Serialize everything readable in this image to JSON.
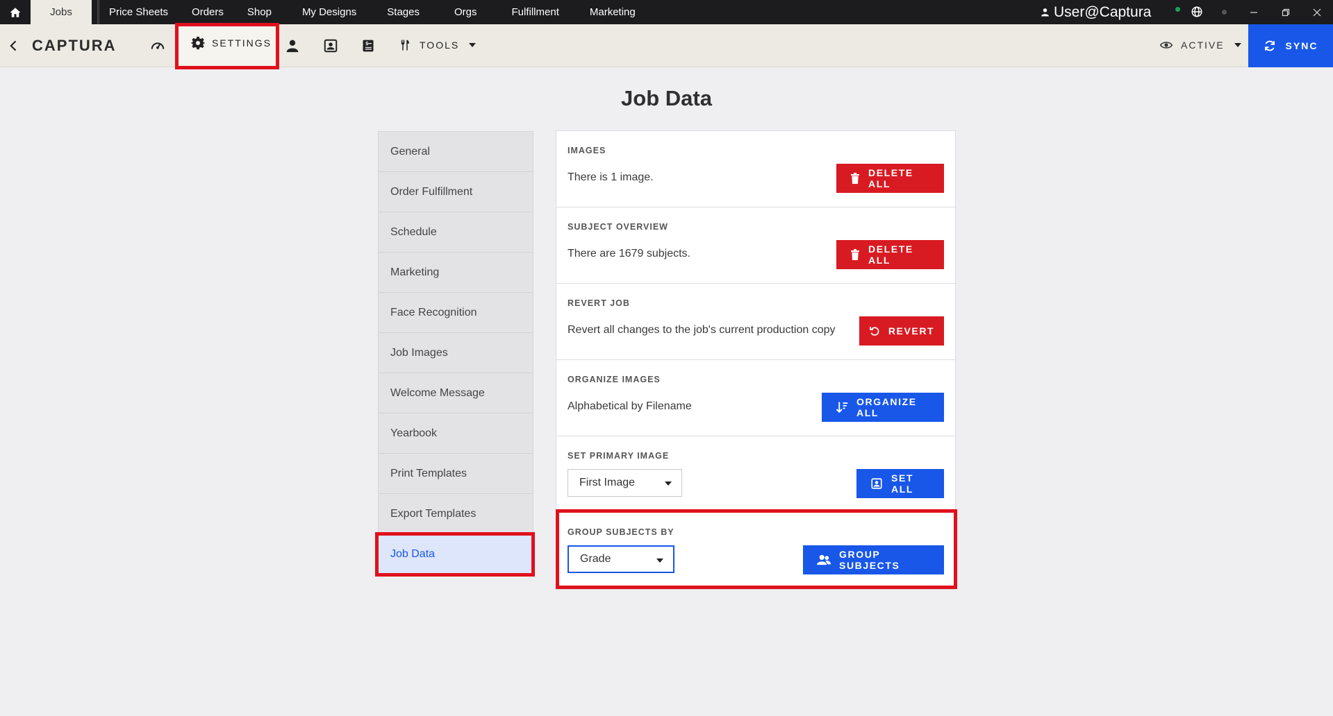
{
  "topbar": {
    "active_tab": "Jobs",
    "tabs": [
      "Price Sheets",
      "Orders",
      "Shop",
      "My Designs",
      "Stages",
      "Orgs",
      "Fulfillment",
      "Marketing"
    ],
    "user": "User@Captura"
  },
  "toolbar": {
    "brand": "CAPTURA",
    "settings_label": "SETTINGS",
    "tools_label": "TOOLS",
    "active_label": "ACTIVE",
    "sync_label": "SYNC"
  },
  "page_title": "Job Data",
  "sidenav": {
    "items": [
      "General",
      "Order Fulfillment",
      "Schedule",
      "Marketing",
      "Face Recognition",
      "Job Images",
      "Welcome Message",
      "Yearbook",
      "Print Templates",
      "Export Templates",
      "Job Data"
    ],
    "active": "Job Data"
  },
  "sections": {
    "images": {
      "heading": "IMAGES",
      "text": "There is 1 image.",
      "button": "DELETE ALL"
    },
    "subjects": {
      "heading": "SUBJECT OVERVIEW",
      "text": "There are 1679 subjects.",
      "button": "DELETE ALL"
    },
    "revert": {
      "heading": "REVERT JOB",
      "text": "Revert all changes to the job's current production copy",
      "button": "REVERT"
    },
    "organize": {
      "heading": "ORGANIZE IMAGES",
      "text": "Alphabetical by Filename",
      "button": "ORGANIZE ALL"
    },
    "primary": {
      "heading": "SET PRIMARY IMAGE",
      "select_value": "First Image",
      "button": "SET ALL"
    },
    "group": {
      "heading": "GROUP SUBJECTS BY",
      "select_value": "Grade",
      "button": "GROUP SUBJECTS"
    }
  },
  "colors": {
    "accent_blue": "#1857e8",
    "danger_red": "#d81b22",
    "highlight_red": "#e0111d",
    "topbar": "#1c1c1e",
    "toolbar": "#eceae3"
  }
}
